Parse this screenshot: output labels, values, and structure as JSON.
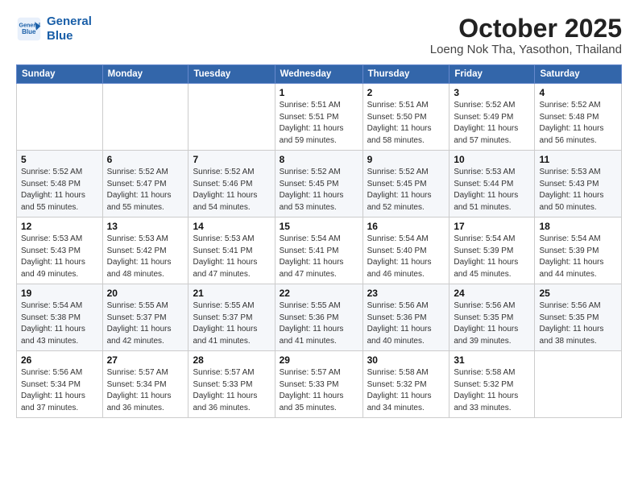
{
  "header": {
    "logo_line1": "General",
    "logo_line2": "Blue",
    "title": "October 2025",
    "subtitle": "Loeng Nok Tha, Yasothon, Thailand"
  },
  "weekdays": [
    "Sunday",
    "Monday",
    "Tuesday",
    "Wednesday",
    "Thursday",
    "Friday",
    "Saturday"
  ],
  "weeks": [
    [
      {
        "day": "",
        "info": ""
      },
      {
        "day": "",
        "info": ""
      },
      {
        "day": "",
        "info": ""
      },
      {
        "day": "1",
        "info": "Sunrise: 5:51 AM\nSunset: 5:51 PM\nDaylight: 11 hours\nand 59 minutes."
      },
      {
        "day": "2",
        "info": "Sunrise: 5:51 AM\nSunset: 5:50 PM\nDaylight: 11 hours\nand 58 minutes."
      },
      {
        "day": "3",
        "info": "Sunrise: 5:52 AM\nSunset: 5:49 PM\nDaylight: 11 hours\nand 57 minutes."
      },
      {
        "day": "4",
        "info": "Sunrise: 5:52 AM\nSunset: 5:48 PM\nDaylight: 11 hours\nand 56 minutes."
      }
    ],
    [
      {
        "day": "5",
        "info": "Sunrise: 5:52 AM\nSunset: 5:48 PM\nDaylight: 11 hours\nand 55 minutes."
      },
      {
        "day": "6",
        "info": "Sunrise: 5:52 AM\nSunset: 5:47 PM\nDaylight: 11 hours\nand 55 minutes."
      },
      {
        "day": "7",
        "info": "Sunrise: 5:52 AM\nSunset: 5:46 PM\nDaylight: 11 hours\nand 54 minutes."
      },
      {
        "day": "8",
        "info": "Sunrise: 5:52 AM\nSunset: 5:45 PM\nDaylight: 11 hours\nand 53 minutes."
      },
      {
        "day": "9",
        "info": "Sunrise: 5:52 AM\nSunset: 5:45 PM\nDaylight: 11 hours\nand 52 minutes."
      },
      {
        "day": "10",
        "info": "Sunrise: 5:53 AM\nSunset: 5:44 PM\nDaylight: 11 hours\nand 51 minutes."
      },
      {
        "day": "11",
        "info": "Sunrise: 5:53 AM\nSunset: 5:43 PM\nDaylight: 11 hours\nand 50 minutes."
      }
    ],
    [
      {
        "day": "12",
        "info": "Sunrise: 5:53 AM\nSunset: 5:43 PM\nDaylight: 11 hours\nand 49 minutes."
      },
      {
        "day": "13",
        "info": "Sunrise: 5:53 AM\nSunset: 5:42 PM\nDaylight: 11 hours\nand 48 minutes."
      },
      {
        "day": "14",
        "info": "Sunrise: 5:53 AM\nSunset: 5:41 PM\nDaylight: 11 hours\nand 47 minutes."
      },
      {
        "day": "15",
        "info": "Sunrise: 5:54 AM\nSunset: 5:41 PM\nDaylight: 11 hours\nand 47 minutes."
      },
      {
        "day": "16",
        "info": "Sunrise: 5:54 AM\nSunset: 5:40 PM\nDaylight: 11 hours\nand 46 minutes."
      },
      {
        "day": "17",
        "info": "Sunrise: 5:54 AM\nSunset: 5:39 PM\nDaylight: 11 hours\nand 45 minutes."
      },
      {
        "day": "18",
        "info": "Sunrise: 5:54 AM\nSunset: 5:39 PM\nDaylight: 11 hours\nand 44 minutes."
      }
    ],
    [
      {
        "day": "19",
        "info": "Sunrise: 5:54 AM\nSunset: 5:38 PM\nDaylight: 11 hours\nand 43 minutes."
      },
      {
        "day": "20",
        "info": "Sunrise: 5:55 AM\nSunset: 5:37 PM\nDaylight: 11 hours\nand 42 minutes."
      },
      {
        "day": "21",
        "info": "Sunrise: 5:55 AM\nSunset: 5:37 PM\nDaylight: 11 hours\nand 41 minutes."
      },
      {
        "day": "22",
        "info": "Sunrise: 5:55 AM\nSunset: 5:36 PM\nDaylight: 11 hours\nand 41 minutes."
      },
      {
        "day": "23",
        "info": "Sunrise: 5:56 AM\nSunset: 5:36 PM\nDaylight: 11 hours\nand 40 minutes."
      },
      {
        "day": "24",
        "info": "Sunrise: 5:56 AM\nSunset: 5:35 PM\nDaylight: 11 hours\nand 39 minutes."
      },
      {
        "day": "25",
        "info": "Sunrise: 5:56 AM\nSunset: 5:35 PM\nDaylight: 11 hours\nand 38 minutes."
      }
    ],
    [
      {
        "day": "26",
        "info": "Sunrise: 5:56 AM\nSunset: 5:34 PM\nDaylight: 11 hours\nand 37 minutes."
      },
      {
        "day": "27",
        "info": "Sunrise: 5:57 AM\nSunset: 5:34 PM\nDaylight: 11 hours\nand 36 minutes."
      },
      {
        "day": "28",
        "info": "Sunrise: 5:57 AM\nSunset: 5:33 PM\nDaylight: 11 hours\nand 36 minutes."
      },
      {
        "day": "29",
        "info": "Sunrise: 5:57 AM\nSunset: 5:33 PM\nDaylight: 11 hours\nand 35 minutes."
      },
      {
        "day": "30",
        "info": "Sunrise: 5:58 AM\nSunset: 5:32 PM\nDaylight: 11 hours\nand 34 minutes."
      },
      {
        "day": "31",
        "info": "Sunrise: 5:58 AM\nSunset: 5:32 PM\nDaylight: 11 hours\nand 33 minutes."
      },
      {
        "day": "",
        "info": ""
      }
    ]
  ]
}
